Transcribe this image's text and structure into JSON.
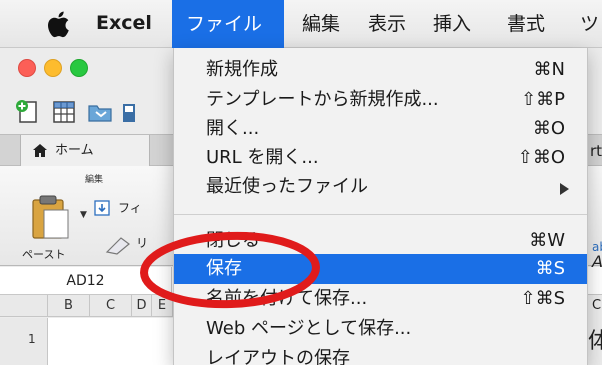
{
  "menubar": {
    "app_name": "Excel",
    "menus": [
      "ファイル",
      "編集",
      "表示",
      "挿入",
      "書式",
      "ツ"
    ]
  },
  "window": {
    "ribbon_tab_home": "ホーム",
    "group_title": "編集",
    "paste_label": "ペースト",
    "name_box_value": "AD12",
    "columns": [
      "B",
      "C",
      "D",
      "E"
    ],
    "row_number": "1",
    "edge_text_1": "rt",
    "edge_text_2": "ab",
    "edge_text_3": "C",
    "edge_text_4": "体",
    "fi_text": "フィ",
    "ri_text": "リ"
  },
  "file_menu": {
    "items": [
      {
        "label": "新規作成",
        "shortcut": "⌘N"
      },
      {
        "label": "テンプレートから新規作成...",
        "shortcut": "⇧⌘P"
      },
      {
        "label": "開く...",
        "shortcut": "⌘O"
      },
      {
        "label": "URL を開く...",
        "shortcut": "⇧⌘O"
      },
      {
        "label": "最近使ったファイル",
        "shortcut": ""
      },
      {
        "label": "閉じる",
        "shortcut": "⌘W"
      },
      {
        "label": "保存",
        "shortcut": "⌘S"
      },
      {
        "label": "名前を付けて保存...",
        "shortcut": "⇧⌘S"
      },
      {
        "label": "Web ページとして保存...",
        "shortcut": ""
      },
      {
        "label": "レイアウトの保存",
        "shortcut": ""
      }
    ],
    "selected_item": "保存"
  },
  "colors": {
    "menu_highlight": "#1a6fe6",
    "annotation": "#e01b1b"
  }
}
